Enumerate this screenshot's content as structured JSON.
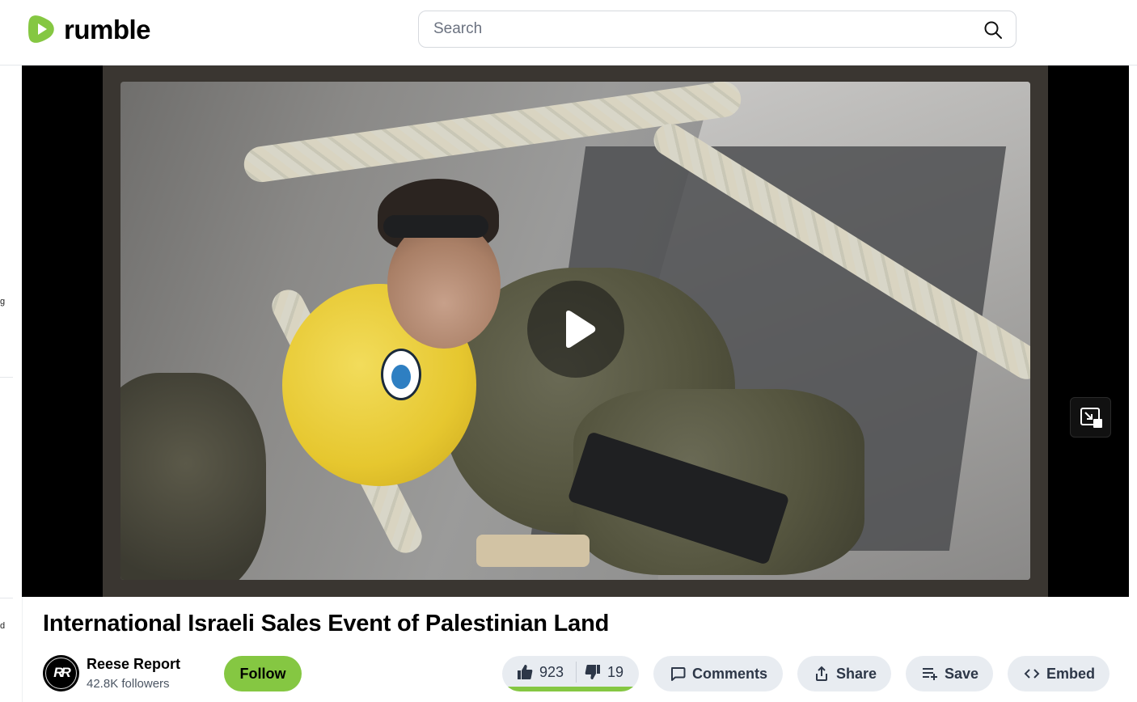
{
  "header": {
    "logo_text": "rumble",
    "search_placeholder": "Search"
  },
  "sidebar": {
    "fragments": [
      "g",
      "d"
    ]
  },
  "video": {
    "title": "International Israeli Sales Event of Palestinian Land"
  },
  "channel": {
    "name": "Reese Report",
    "followers": "42.8K followers",
    "follow_label": "Follow"
  },
  "votes": {
    "up": "923",
    "down": "19",
    "up_ratio": 0.98
  },
  "actions": {
    "comments": "Comments",
    "share": "Share",
    "save": "Save",
    "embed": "Embed"
  },
  "colors": {
    "brand_green": "#85c742",
    "pill_bg": "#e8ecf1"
  },
  "icons": [
    "rumble-logo-icon",
    "search-icon",
    "play-icon",
    "picture-in-picture-icon",
    "thumbs-up-icon",
    "thumbs-down-icon",
    "comment-icon",
    "share-icon",
    "playlist-add-icon",
    "code-icon"
  ]
}
